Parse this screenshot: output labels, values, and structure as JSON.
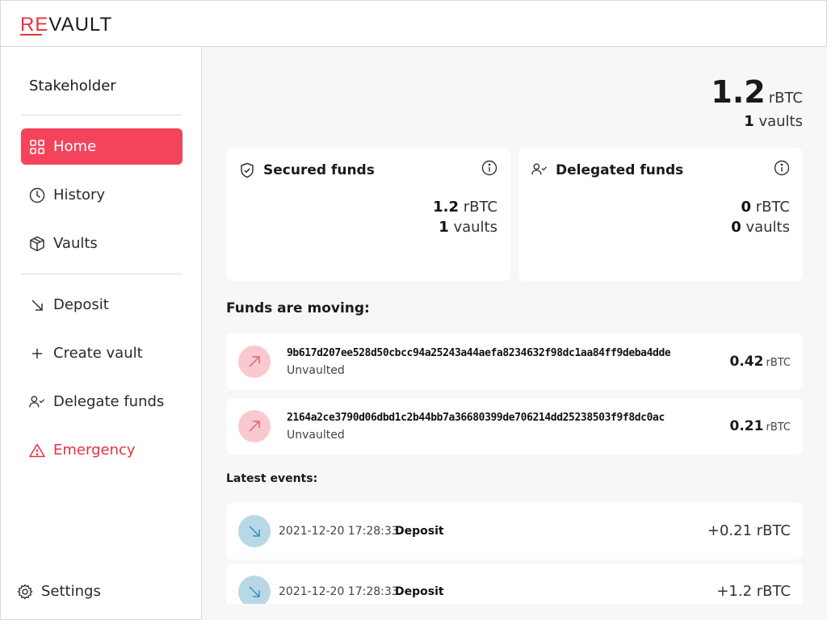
{
  "brand": {
    "re": "RE",
    "vault": "VAULT",
    "accent": "#e8313f"
  },
  "sidebar": {
    "role": "Stakeholder",
    "items": [
      {
        "label": "Home",
        "icon": "grid-icon",
        "active": true
      },
      {
        "label": "History",
        "icon": "clock-icon"
      },
      {
        "label": "Vaults",
        "icon": "box-icon"
      },
      {
        "label": "Deposit",
        "icon": "arrow-down-right-icon"
      },
      {
        "label": "Create vault",
        "icon": "plus-icon"
      },
      {
        "label": "Delegate funds",
        "icon": "user-check-icon"
      },
      {
        "label": "Emergency",
        "icon": "warning-icon"
      }
    ],
    "settings_label": "Settings"
  },
  "summary": {
    "amount": "1.2",
    "unit": "rBTC",
    "vaults_count": "1",
    "vaults_label": "vaults"
  },
  "cards": {
    "secured": {
      "title": "Secured funds",
      "amount": "1.2",
      "unit": "rBTC",
      "vaults": "1",
      "vaults_label": "vaults"
    },
    "delegated": {
      "title": "Delegated funds",
      "amount": "0",
      "unit": "rBTC",
      "vaults": "0",
      "vaults_label": "vaults"
    }
  },
  "moving": {
    "title": "Funds are moving:",
    "rows": [
      {
        "txid": "9b617d207ee528d50cbcc94a25243a44aefa8234632f98dc1aa84ff9deba4dde",
        "status": "Unvaulted",
        "amount": "0.42",
        "unit": "rBTC"
      },
      {
        "txid": "2164a2ce3790d06dbd1c2b44bb7a36680399de706214dd25238503f9f8dc0ac",
        "status": "Unvaulted",
        "amount": "0.21",
        "unit": "rBTC"
      }
    ]
  },
  "events": {
    "title": "Latest events:",
    "rows": [
      {
        "date": "2021-12-20 17:28:33",
        "kind": "Deposit",
        "amount": "+0.21 rBTC"
      },
      {
        "date": "2021-12-20 17:28:33",
        "kind": "Deposit",
        "amount": "+1.2 rBTC"
      }
    ]
  }
}
